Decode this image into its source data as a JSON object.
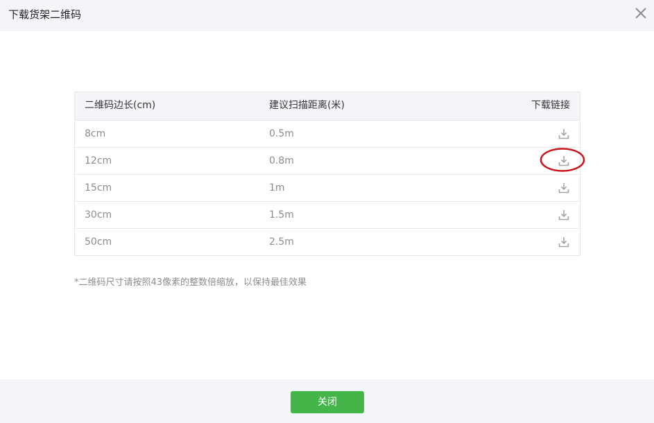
{
  "dialog": {
    "title": "下载货架二维码",
    "close_icon": "close-icon"
  },
  "table": {
    "headers": {
      "size": "二维码边长(cm)",
      "distance": "建议扫描距离(米)",
      "link": "下载链接"
    },
    "rows": [
      {
        "size": "8cm",
        "distance": "0.5m",
        "icon": "download-icon"
      },
      {
        "size": "12cm",
        "distance": "0.8m",
        "icon": "download-icon",
        "highlighted": true
      },
      {
        "size": "15cm",
        "distance": "1m",
        "icon": "download-icon"
      },
      {
        "size": "30cm",
        "distance": "1.5m",
        "icon": "download-icon"
      },
      {
        "size": "50cm",
        "distance": "2.5m",
        "icon": "download-icon"
      }
    ]
  },
  "note": "*二维码尺寸请按照43像素的整数倍缩放，以保持最佳效果",
  "footer": {
    "close_button_label": "关闭"
  },
  "colors": {
    "primary_button": "#44b549",
    "highlight_ring": "#c8141a",
    "header_bg": "#f4f5f9",
    "border": "#e4e8eb",
    "muted_text": "#8d8d8d"
  }
}
